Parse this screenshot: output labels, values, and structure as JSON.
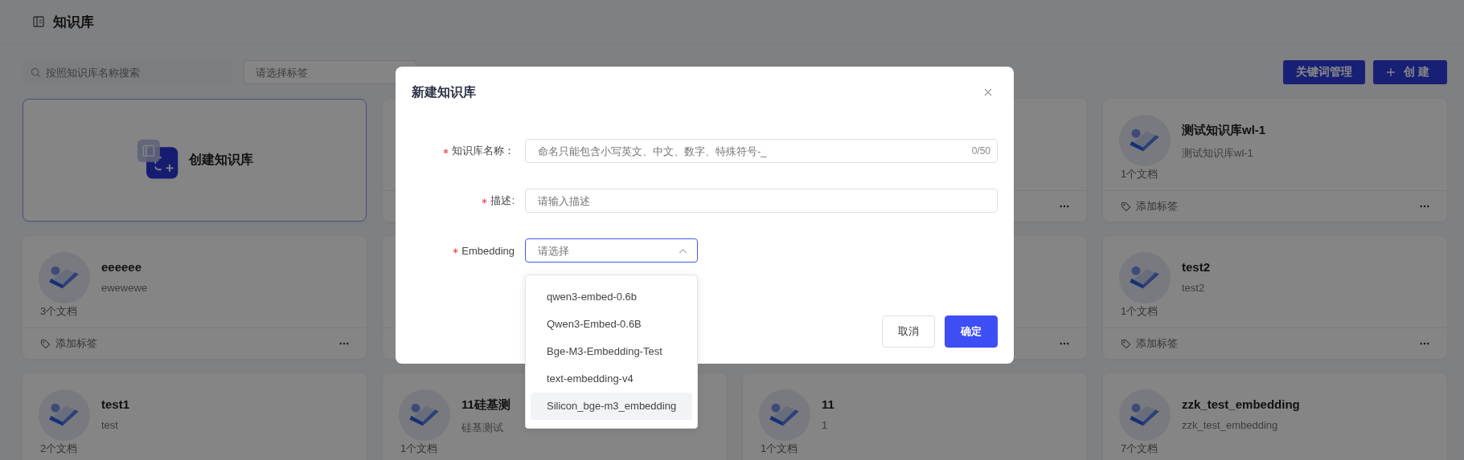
{
  "header": {
    "title": "知识库"
  },
  "toolbar": {
    "search": {
      "placeholder": "按照知识库名称搜索"
    },
    "tag_select": {
      "placeholder": "请选择标签"
    },
    "buttons": [
      {
        "label": "关键词管理",
        "kind": "text"
      },
      {
        "label": "创 建",
        "kind": "create"
      }
    ]
  },
  "create_card": {
    "label": "创建知识库"
  },
  "cards": [
    {
      "kind": "covered"
    },
    {
      "kind": "covered_menu"
    },
    {
      "kind": "library",
      "title": "测试知识库wl-1",
      "description": "测试知识库wl-1",
      "doc_count": "1个文档",
      "tag_label": "添加标签"
    },
    {
      "kind": "library",
      "title": "eeeeee",
      "description": "ewewewe",
      "doc_count": "3个文档",
      "tag_label": "添加标签"
    },
    {
      "kind": "covered"
    },
    {
      "kind": "covered_menu"
    },
    {
      "kind": "library",
      "title": "test2",
      "description": "test2",
      "doc_count": "1个文档",
      "tag_label": "添加标签"
    },
    {
      "kind": "library",
      "title": "test1",
      "description": "test",
      "doc_count": "2个文档"
    },
    {
      "kind": "library",
      "title": "11硅基测",
      "description": "硅基测试",
      "doc_count": "1个文档"
    },
    {
      "kind": "library",
      "title": "11",
      "description": "1",
      "doc_count": "1个文档"
    },
    {
      "kind": "library",
      "title": "zzk_test_embedding",
      "description": "zzk_test_embedding",
      "doc_count": "7个文档"
    }
  ],
  "modal": {
    "title": "新建知识库",
    "fields": [
      {
        "kind": "text",
        "label": "知识库名称：",
        "required": true,
        "placeholder": "命名只能包含小写英文、中文、数字、特殊符号-_",
        "counter": "0/50"
      },
      {
        "kind": "text",
        "label": "描述:",
        "required": true,
        "placeholder": "请输入描述"
      },
      {
        "kind": "select",
        "label": "Embedding",
        "required": true,
        "placeholder": "请选择",
        "open": true
      }
    ],
    "options": [
      {
        "label": "qwen3-embed-0.6b",
        "selected": false
      },
      {
        "label": "Qwen3-Embed-0.6B",
        "selected": false
      },
      {
        "label": "Bge-M3-Embedding-Test",
        "selected": false
      },
      {
        "label": "text-embedding-v4",
        "selected": false
      },
      {
        "label": "Silicon_bge-m3_embedding",
        "selected": true
      }
    ],
    "buttons": [
      {
        "label": "取消",
        "kind": "secondary"
      },
      {
        "label": "确定",
        "kind": "primary"
      }
    ]
  }
}
